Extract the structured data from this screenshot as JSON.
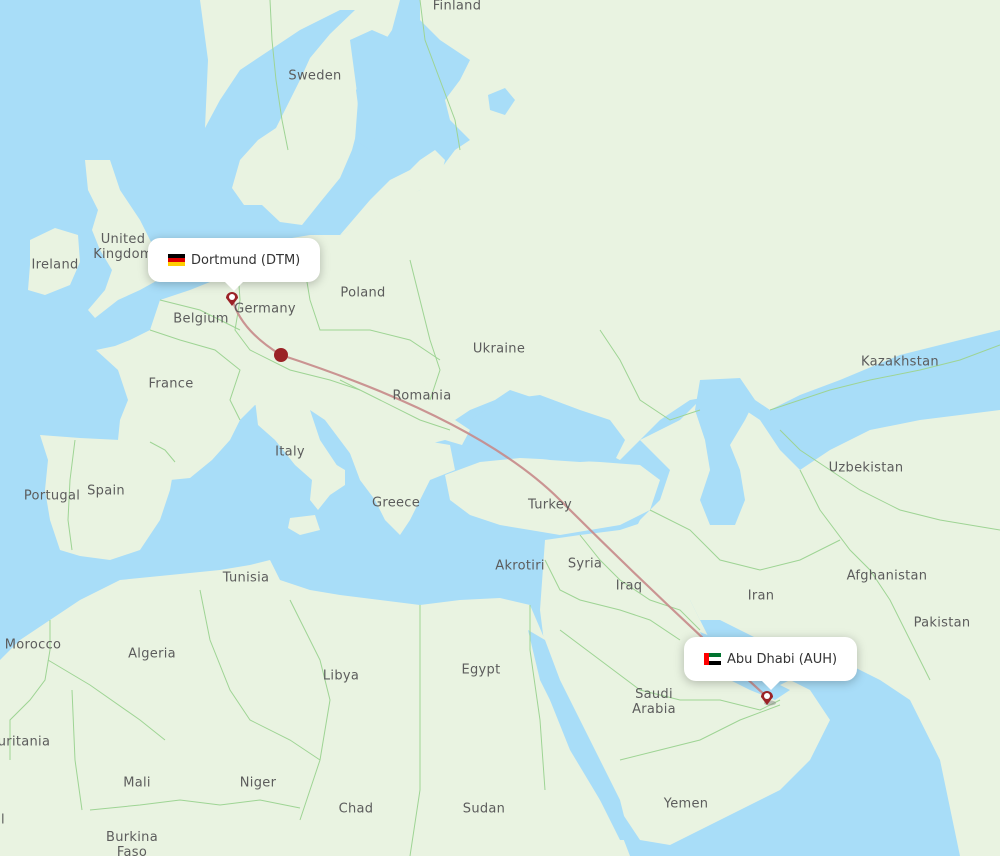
{
  "map": {
    "colors": {
      "water": "#a8ddf8",
      "land": "#e9f3e1",
      "border": "#9ed494",
      "route": "#c78a8a",
      "marker": "#9b2226"
    },
    "labels": [
      {
        "id": "finland",
        "text": "Finland"
      },
      {
        "id": "sweden",
        "text": "Sweden"
      },
      {
        "id": "united-kingdom",
        "text": "United\nKingdom"
      },
      {
        "id": "ireland",
        "text": "Ireland"
      },
      {
        "id": "germany",
        "text": "Germany"
      },
      {
        "id": "poland",
        "text": "Poland"
      },
      {
        "id": "belgium",
        "text": "Belgium"
      },
      {
        "id": "ukraine",
        "text": "Ukraine"
      },
      {
        "id": "france",
        "text": "France"
      },
      {
        "id": "kazakhstan",
        "text": "Kazakhstan"
      },
      {
        "id": "romania",
        "text": "Romania"
      },
      {
        "id": "italy",
        "text": "Italy"
      },
      {
        "id": "uzbekistan",
        "text": "Uzbekistan"
      },
      {
        "id": "spain",
        "text": "Spain"
      },
      {
        "id": "portugal",
        "text": "Portugal"
      },
      {
        "id": "greece",
        "text": "Greece"
      },
      {
        "id": "turkey",
        "text": "Turkey"
      },
      {
        "id": "tunisia",
        "text": "Tunisia"
      },
      {
        "id": "akrotiri",
        "text": "Akrotiri"
      },
      {
        "id": "syria",
        "text": "Syria"
      },
      {
        "id": "afghanistan",
        "text": "Afghanistan"
      },
      {
        "id": "iraq",
        "text": "Iraq"
      },
      {
        "id": "iran",
        "text": "Iran"
      },
      {
        "id": "pakistan",
        "text": "Pakistan"
      },
      {
        "id": "morocco",
        "text": "Morocco"
      },
      {
        "id": "algeria",
        "text": "Algeria"
      },
      {
        "id": "libya",
        "text": "Libya"
      },
      {
        "id": "egypt",
        "text": "Egypt"
      },
      {
        "id": "saudi-arabia",
        "text": "Saudi\nArabia"
      },
      {
        "id": "mauritania",
        "text": "uritania"
      },
      {
        "id": "mali",
        "text": "Mali"
      },
      {
        "id": "niger",
        "text": "Niger"
      },
      {
        "id": "chad",
        "text": "Chad"
      },
      {
        "id": "sudan",
        "text": "Sudan"
      },
      {
        "id": "yemen",
        "text": "Yemen"
      },
      {
        "id": "burkina-faso",
        "text": "Burkina\nFaso"
      },
      {
        "id": "senegal-fragment",
        "text": "l"
      }
    ]
  },
  "route": {
    "origin": {
      "city": "Dortmund",
      "code": "DTM",
      "label": "Dortmund (DTM)",
      "flag": "germany-flag"
    },
    "destination": {
      "city": "Abu Dhabi",
      "code": "AUH",
      "label": "Abu Dhabi (AUH)",
      "flag": "uae-flag"
    }
  }
}
